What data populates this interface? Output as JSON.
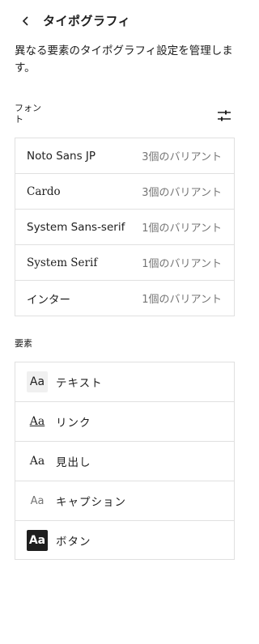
{
  "header": {
    "title": "タイポグラフィ",
    "back_icon": "chevron-left-icon"
  },
  "description": "異なる要素のタイポグラフィ設定を管理します。",
  "fonts": {
    "label": "フォント",
    "filter_icon": "sliders-icon",
    "items": [
      {
        "name": "Noto Sans JP",
        "variants": "3個のバリアント"
      },
      {
        "name": "Cardo",
        "variants": "3個のバリアント"
      },
      {
        "name": "System Sans-serif",
        "variants": "1個のバリアント"
      },
      {
        "name": "System Serif",
        "variants": "1個のバリアント"
      },
      {
        "name": "インター",
        "variants": "1個のバリアント"
      }
    ]
  },
  "elements": {
    "label": "要素",
    "items": [
      {
        "preview": "Aa",
        "label": "テキスト"
      },
      {
        "preview": "Aa",
        "label": "リンク"
      },
      {
        "preview": "Aa",
        "label": "見出し"
      },
      {
        "preview": "Aa",
        "label": "キャプション"
      },
      {
        "preview": "Aa",
        "label": "ボタン"
      }
    ]
  }
}
